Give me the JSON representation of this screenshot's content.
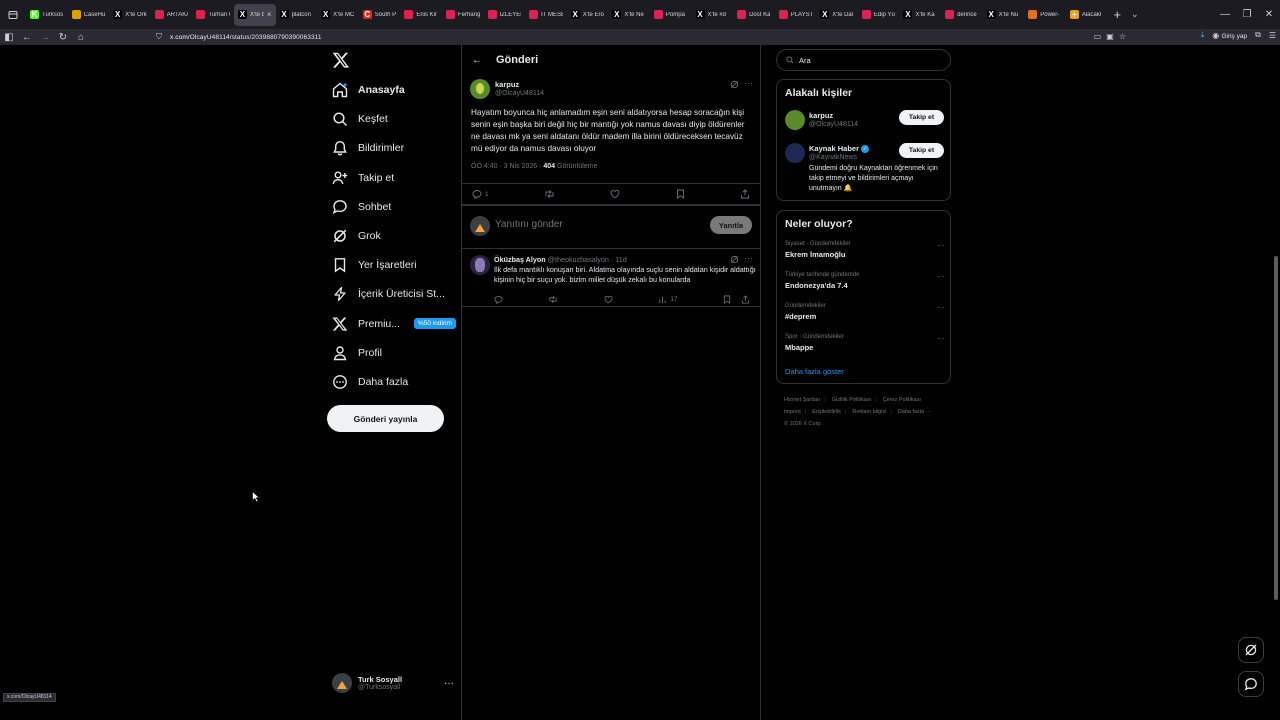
{
  "browser": {
    "tabs": [
      {
        "title": "Turksos",
        "fav": "K",
        "color": "#53fc18"
      },
      {
        "title": "CaseHu",
        "fav": "",
        "color": "#e3a000"
      },
      {
        "title": "X'te Ork",
        "fav": "X",
        "color": "#000000"
      },
      {
        "title": "ARTAKA",
        "fav": "",
        "color": "#e02050"
      },
      {
        "title": "Turhan Ö",
        "fav": "",
        "color": "#e02050"
      },
      {
        "title": "X'te bi",
        "fav": "X",
        "color": "#000000",
        "active": true
      },
      {
        "title": "platcon",
        "fav": "X",
        "color": "#000000"
      },
      {
        "title": "X'te MC",
        "fav": "X",
        "color": "#000000"
      },
      {
        "title": "South P",
        "fav": "C",
        "color": "#d62d20"
      },
      {
        "title": "Enis Kir",
        "fav": "",
        "color": "#e02050"
      },
      {
        "title": "Ferhang",
        "fav": "",
        "color": "#e02050"
      },
      {
        "title": "İZLEYEN",
        "fav": "",
        "color": "#e02050"
      },
      {
        "title": "İT MESE",
        "fav": "",
        "color": "#e02050"
      },
      {
        "title": "X'te Ero",
        "fav": "X",
        "color": "#000000"
      },
      {
        "title": "X'te Ne",
        "fav": "X",
        "color": "#000000"
      },
      {
        "title": "Pompa",
        "fav": "",
        "color": "#e02050"
      },
      {
        "title": "X'te #d",
        "fav": "X",
        "color": "#000000"
      },
      {
        "title": "Dost Ka",
        "fav": "",
        "color": "#e02050"
      },
      {
        "title": "PLAYSTA",
        "fav": "",
        "color": "#e02050"
      },
      {
        "title": "X'te Dal",
        "fav": "X",
        "color": "#000000"
      },
      {
        "title": "Edip Yü",
        "fav": "",
        "color": "#e02050"
      },
      {
        "title": "X'te Ka",
        "fav": "X",
        "color": "#000000"
      },
      {
        "title": "derince",
        "fav": "",
        "color": "#e02050"
      },
      {
        "title": "X'te Nu",
        "fav": "X",
        "color": "#000000"
      },
      {
        "title": "Power-",
        "fav": "",
        "color": "#e07020"
      },
      {
        "title": "Alacakl",
        "fav": "+",
        "color": "#f0a020"
      }
    ],
    "url_host": "x.com",
    "url_path": "/OlcayU48114/status/2039880790390063311",
    "login_label": "Giriş yap",
    "status_text": "x.com/OlcayU48114"
  },
  "nav": {
    "items": [
      {
        "label": "Anasayfa",
        "icon": "home-icon"
      },
      {
        "label": "Keşfet",
        "icon": "search-icon"
      },
      {
        "label": "Bildirimler",
        "icon": "bell-icon"
      },
      {
        "label": "Takip et",
        "icon": "person-add-icon"
      },
      {
        "label": "Sohbet",
        "icon": "chat-icon"
      },
      {
        "label": "Grok",
        "icon": "grok-icon"
      },
      {
        "label": "Yer İşaretleri",
        "icon": "bookmark-icon"
      },
      {
        "label": "İçerik Üreticisi St...",
        "icon": "lightning-icon"
      },
      {
        "label": "Premiu...",
        "icon": "x-logo-icon"
      },
      {
        "label": "Profil",
        "icon": "profile-icon"
      },
      {
        "label": "Daha fazla",
        "icon": "more-circle-icon"
      }
    ],
    "premium_badge": "%50 indirim",
    "post_button": "Gönderi yayınla",
    "account": {
      "name": "Turk Sosyall",
      "handle": "@Turksosyall"
    }
  },
  "main": {
    "header_title": "Gönderi",
    "post": {
      "name": "karpuz",
      "handle": "@OlcayU48114",
      "text": "Hayatım boyunca hiç anlamadım eşin seni aldatıyorsa hesap soracağın kişi senin eşin başka biri değil hiç bir mantığı yok namus davası diyip öldürenler ne davası mk ya seni aldatanı öldür madem illa birini öldüreceksen tecavüz mü ediyor da namus davası oluyor",
      "time": "ÖÖ 4:40 · 3 Nis 2026 · ",
      "views": "404",
      "views_label": " Görüntüleme",
      "replies": "1"
    },
    "reply_placeholder": "Yanıtını gönder",
    "reply_button": "Yanıtla",
    "reply": {
      "name": "Öküzbaş Alyon",
      "handle": "@theokuzbasalyon · 11d",
      "text": "İlk defa mantıklı konuşan biri. Aldatma olayında suçlu senin aldatan kişidir aldattığı kişinin hiç bir suçu yok. bizim millet düşük zekalı bu konularda",
      "views": "17"
    }
  },
  "right": {
    "search_placeholder": "Ara",
    "related_title": "Alakalı kişiler",
    "people": [
      {
        "name": "karpuz",
        "handle": "@OlcayU48114",
        "follow": "Takip et",
        "bio": "",
        "verified": false
      },
      {
        "name": "Kaynak Haber",
        "handle": "@KaynakNews",
        "follow": "Takip et",
        "bio": "Gündemi doğru Kaynaktan öğrenmek için takip etmeyi ve bildirimleri açmayı unutmayın 🔔",
        "verified": true
      }
    ],
    "trends_title": "Neler oluyor?",
    "trends": [
      {
        "context": "Siyaset · Gündemdekiler",
        "title": "Ekrem İmamoğlu"
      },
      {
        "context": "Türkiye tarihinde gündemde",
        "title": "Endonezya'da 7.4"
      },
      {
        "context": "Gündemdekiler",
        "title": "#deprem"
      },
      {
        "context": "Spor · Gündemdekiler",
        "title": "Mbappe"
      }
    ],
    "show_more": "Daha fazla göster",
    "footer": [
      "Hizmet Şartları",
      "Gizlilik Politikası",
      "Çerez Politikası",
      "Imprint",
      "Erişilebilirlik",
      "Reklam bilgisi",
      "Daha fazla ···",
      "© 2026 X Corp."
    ]
  },
  "colors": {
    "accent": "#1d9bf0",
    "bg": "#000000",
    "border": "#2f3336",
    "muted": "#71767b"
  }
}
